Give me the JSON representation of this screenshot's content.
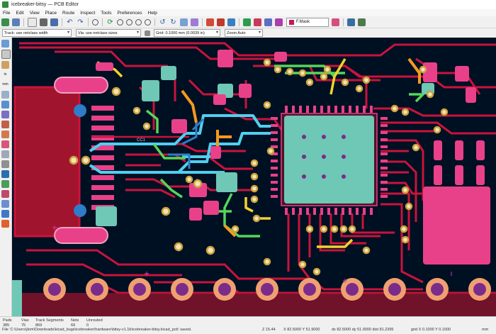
{
  "window": {
    "title": "icebreaker-bitsy — PCB Editor"
  },
  "menu": [
    "File",
    "Edit",
    "View",
    "Place",
    "Route",
    "Inspect",
    "Tools",
    "Preferences",
    "Help"
  ],
  "toolbar": {
    "active_layer": "F.Mask",
    "active_layer_color": "#c2185b"
  },
  "toolbar2": {
    "track_width": "Track: use netclass width",
    "via_size": "Via: use netclass sizes",
    "grid": "Grid: 0.1000 mm (0.0039 in)",
    "zoom": "Zoom Auto"
  },
  "canvas": {
    "background": "#001023",
    "net_label": "CC1",
    "colors": {
      "copper_front": "#c8143c",
      "pads": "#e8418a",
      "pad_teal": "#6fc7b5",
      "zone_red": "#a0142d",
      "pin_ring": "#f0a070",
      "pin_hole": "#7b2c8a",
      "trace_cyan": "#4fd0ef",
      "trace_yellow": "#f2d230",
      "trace_green": "#55d65a",
      "trace_orange": "#f59a1e",
      "via_center": "#f3e4b5",
      "trace_blue": "#2f7cc8"
    }
  },
  "status": {
    "pads_label": "Pads",
    "pads_value": "385",
    "vias_label": "Vias",
    "vias_value": "75",
    "track_label": "Track Segments",
    "track_value": "869",
    "nets_label": "Nets",
    "nets_value": "69",
    "unrouted_label": "Unrouted",
    "unrouted_value": "0",
    "message": "File 'C:\\Users\\jlom\\Downloads\\kicad_bugs\\icebreaker\\hardware\\bitsy-v1.1b\\icebreaker-bitsy.kicad_pcb' saved.",
    "zoom": "Z 15.44",
    "xy": "X 82.5000  Y 51.9000",
    "dxy": "dx 82.5000  dy 51.9000  dist 81.2395",
    "grid": "grid X 0.1000  Y 0.1000",
    "units": "mm"
  }
}
